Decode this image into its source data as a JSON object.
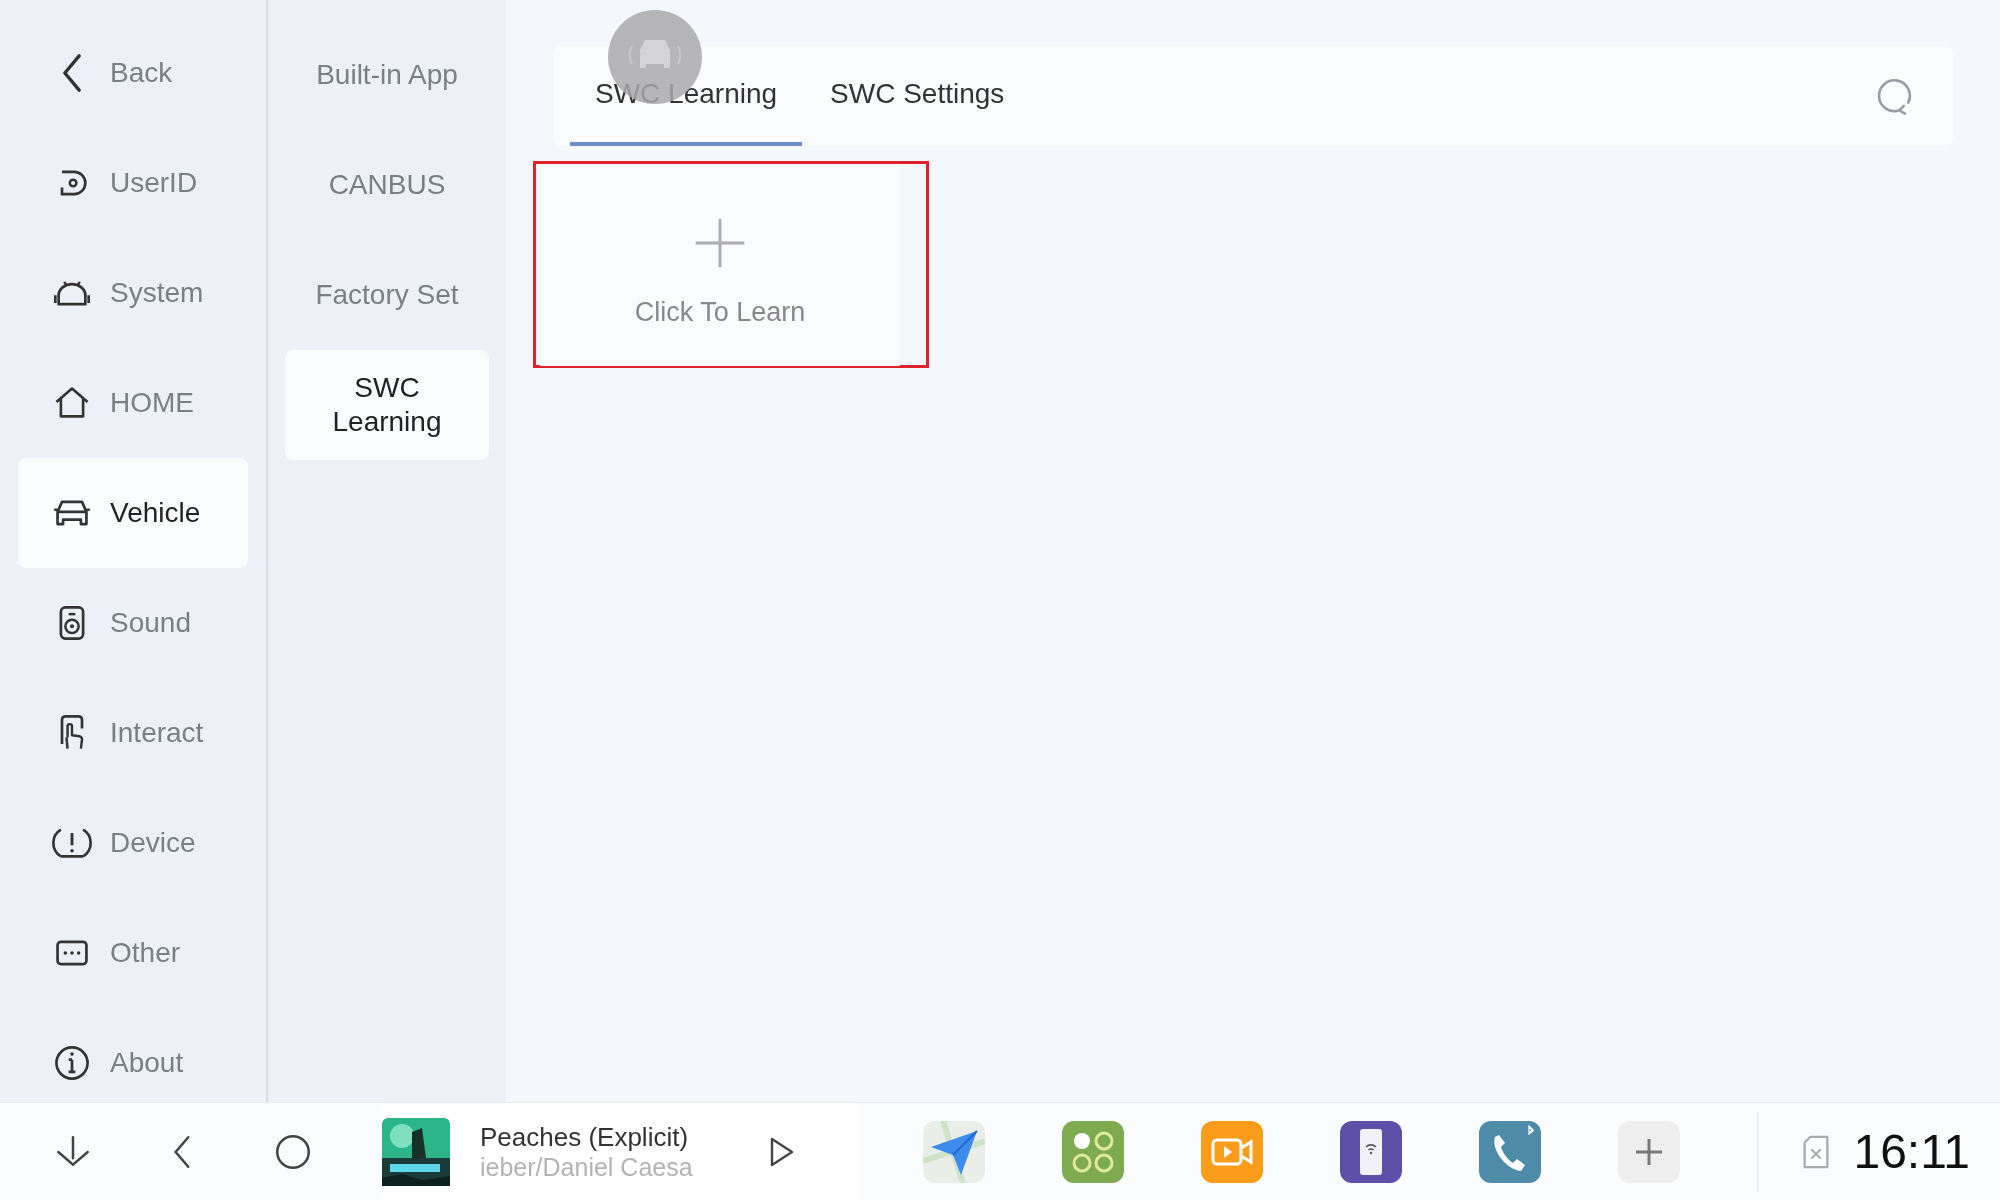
{
  "sidebar": {
    "items": [
      {
        "label": "Back",
        "selected": false
      },
      {
        "label": "UserID",
        "selected": false
      },
      {
        "label": "System",
        "selected": false
      },
      {
        "label": "HOME",
        "selected": false
      },
      {
        "label": "Vehicle",
        "selected": true
      },
      {
        "label": "Sound",
        "selected": false
      },
      {
        "label": "Interact",
        "selected": false
      },
      {
        "label": "Device",
        "selected": false
      },
      {
        "label": "Other",
        "selected": false
      },
      {
        "label": "About",
        "selected": false
      }
    ]
  },
  "submenu": {
    "items": [
      {
        "label": "Built-in App",
        "selected": false
      },
      {
        "label": "CANBUS",
        "selected": false
      },
      {
        "label": "Factory Set",
        "selected": false
      },
      {
        "label": "SWC Learning",
        "selected": true
      }
    ]
  },
  "tabs": [
    {
      "label": "SWC Learning",
      "selected": true
    },
    {
      "label": "SWC Settings",
      "selected": false
    }
  ],
  "learn_card": {
    "label": "Click To Learn",
    "highlighted": true
  },
  "media": {
    "title": "Peaches (Explicit)",
    "artist": "ieber/Daniel Caesa"
  },
  "clock": "16:11"
}
